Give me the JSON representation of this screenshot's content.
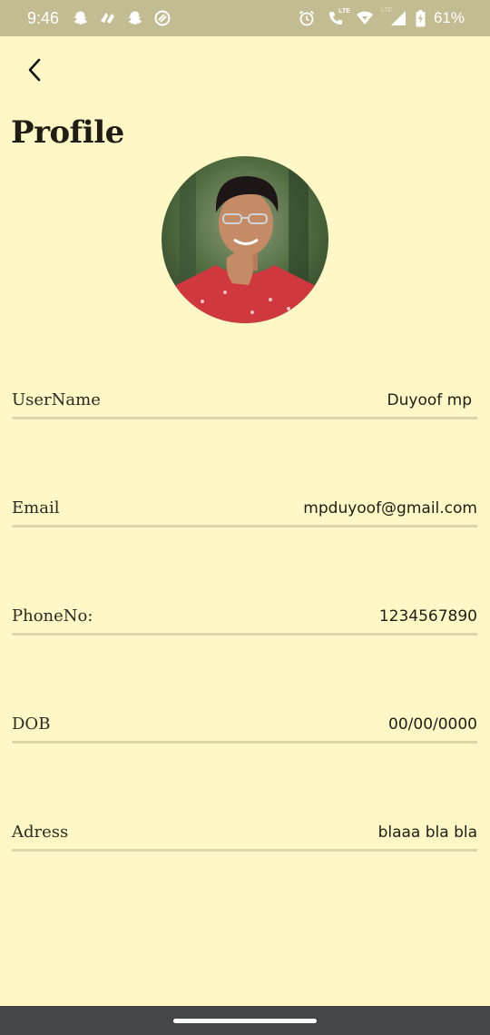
{
  "status_bar": {
    "time": "9:46",
    "left_icons": [
      "snapchat-icon",
      "app-notification-icon",
      "snapchat-icon",
      "do-not-disturb-icon"
    ],
    "right_icons": [
      "alarm-icon",
      "lte-call-icon",
      "wifi-icon",
      "signal-icon",
      "battery-icon"
    ],
    "battery": "61%",
    "lte_label_1": "LTE",
    "lte_label_2": "LTE"
  },
  "header": {
    "back_icon": "chevron-left-icon",
    "title": "Profile"
  },
  "profile": {
    "avatar": "profile-photo",
    "fields": [
      {
        "label": "UserName",
        "value": "Duyoof mp"
      },
      {
        "label": "Email",
        "value": "mpduyoof@gmail.com"
      },
      {
        "label": "PhoneNo:",
        "value": "1234567890"
      },
      {
        "label": "DOB",
        "value": "00/00/0000"
      },
      {
        "label": "Adress",
        "value": "blaaa bla bla"
      }
    ]
  },
  "colors": {
    "background": "#fff8c6",
    "status_bar": "#c3bc93",
    "divider": "#ddd6a6",
    "nav_bar": "#434549"
  }
}
